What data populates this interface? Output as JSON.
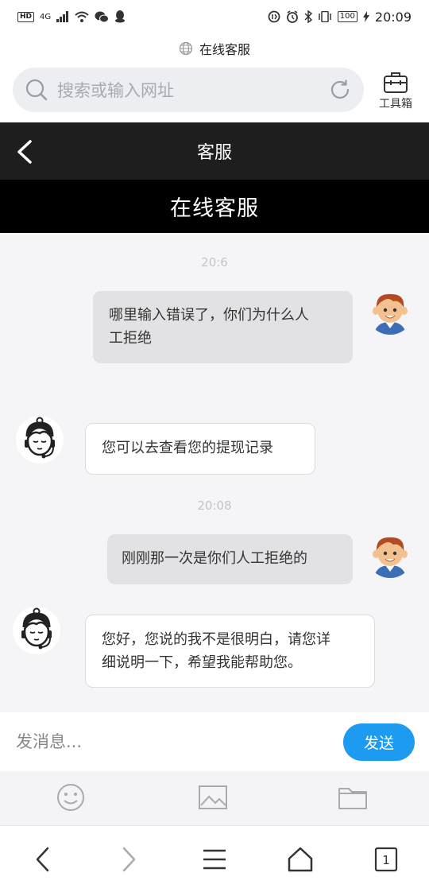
{
  "status_bar": {
    "left_badges": [
      "HD",
      "4G"
    ],
    "battery": "100",
    "time": "20:09"
  },
  "browser": {
    "page_title": "在线客服",
    "search_placeholder": "搜索或输入网址",
    "toolbox_label": "工具箱",
    "tab_count": "1"
  },
  "header": {
    "title": "客服",
    "banner": "在线客服"
  },
  "chat": {
    "messages": [
      {
        "time": "20:6",
        "direction": "out",
        "text_lines": [
          "哪里输入错误了，你们为什么人",
          "工拒绝"
        ]
      },
      {
        "direction": "in",
        "text_lines": [
          "您可以去查看您的提现记录"
        ]
      },
      {
        "time": "20:08",
        "direction": "out",
        "text_lines": [
          "刚刚那一次是你们人工拒绝的"
        ]
      },
      {
        "direction": "in",
        "text_lines": [
          "您好，您说的我不是很明白，请您详",
          "细说明一下，希望我能帮助您。"
        ]
      }
    ]
  },
  "composer": {
    "placeholder": "发消息...",
    "send_label": "发送"
  },
  "colors": {
    "header_bg": "#1e1e1e",
    "banner_bg": "#000000",
    "send_button": "#1d9bf0",
    "chat_bg": "#f5f5f7"
  },
  "icons": {
    "tools": [
      "emoji-icon",
      "image-icon",
      "folder-icon"
    ],
    "nav": [
      "back-icon",
      "forward-icon",
      "menu-icon",
      "home-icon",
      "tabs-icon"
    ]
  }
}
